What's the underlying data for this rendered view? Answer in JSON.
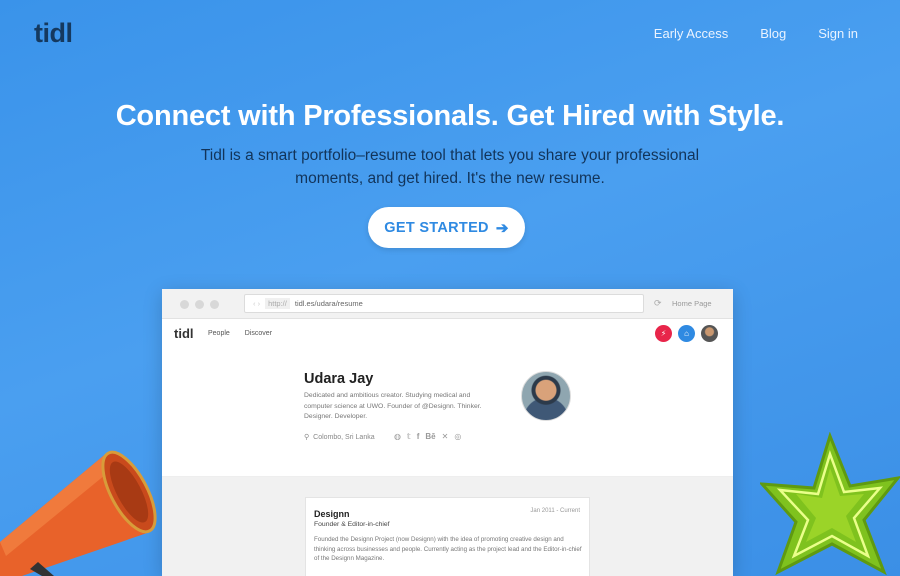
{
  "nav": {
    "logo": "tidl",
    "links": [
      "Early Access",
      "Blog",
      "Sign in"
    ]
  },
  "hero": {
    "title": "Connect with Professionals. Get Hired with Style.",
    "subtitle": "Tidl is a smart portfolio–resume tool that lets you share your professional moments, and get hired. It's the new resume.",
    "cta_label": "GET STARTED",
    "cta_icon": "arrow-right-icon"
  },
  "browser": {
    "protocol": "http://",
    "url": "tidl.es/udara/resume",
    "home_label": "Home Page",
    "app": {
      "logo": "tidl",
      "nav": [
        "People",
        "Discover"
      ],
      "badges": [
        {
          "icon": "bolt-icon",
          "color": "#e8254a"
        },
        {
          "icon": "home-icon",
          "color": "#2f8ae2"
        },
        {
          "icon": "user-avatar-icon",
          "color": "#666666"
        }
      ]
    },
    "profile": {
      "name": "Udara Jay",
      "bio": "Dedicated and ambitious creator. Studying medical and computer science at UWO. Founder of @Designn. Thinker. Designer. Developer.",
      "location": "Colombo, Sri Lanka",
      "social_icons": [
        "globe-icon",
        "twitter-icon",
        "facebook-icon",
        "behance-icon",
        "bolt-icon",
        "dribbble-icon"
      ]
    },
    "experience": {
      "title": "Designn",
      "role": "Founder & Editor-in-chief",
      "date": "Jan 2011 - Current",
      "description": "Founded the Designn Project (now Designn) with the idea of promoting creative design and thinking across businesses and people. Currently acting as the project lead and the Editor-in-chief of the Designn Magazine."
    }
  },
  "colors": {
    "background": "#3f97ec",
    "logo": "#15395f",
    "cta_text": "#2f8ae2"
  }
}
